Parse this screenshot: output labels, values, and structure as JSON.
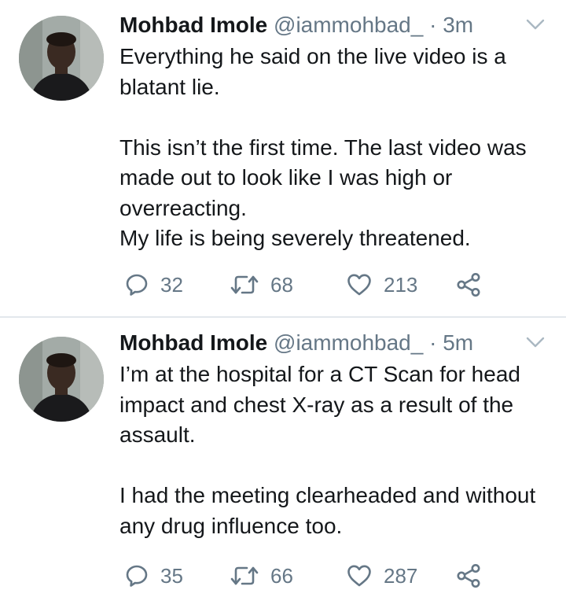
{
  "tweets": [
    {
      "name": "Mohbad Imole",
      "handle": "@iammohbad_",
      "separator": "·",
      "time": "3m",
      "text": "Everything he said on the live video is a blatant lie.\n\nThis isn’t the first time. The last video was made out to look like I was high or overreacting.\nMy life is being severely threatened.",
      "replies": "32",
      "retweets": "68",
      "likes": "213"
    },
    {
      "name": "Mohbad Imole",
      "handle": "@iammohbad_",
      "separator": "·",
      "time": "5m",
      "text": "I’m at the hospital for a CT Scan for head impact and chest X-ray as a result of the assault.\n\nI had the meeting clearheaded and without any drug influence too.",
      "replies": "35",
      "retweets": "66",
      "likes": "287"
    }
  ],
  "icons": {
    "reply": "reply-icon",
    "retweet": "retweet-icon",
    "like": "heart-icon",
    "share": "share-icon",
    "menu": "chevron-down-icon"
  },
  "colors": {
    "text": "#14171a",
    "secondary": "#657786",
    "divider": "#e3e8ec"
  }
}
